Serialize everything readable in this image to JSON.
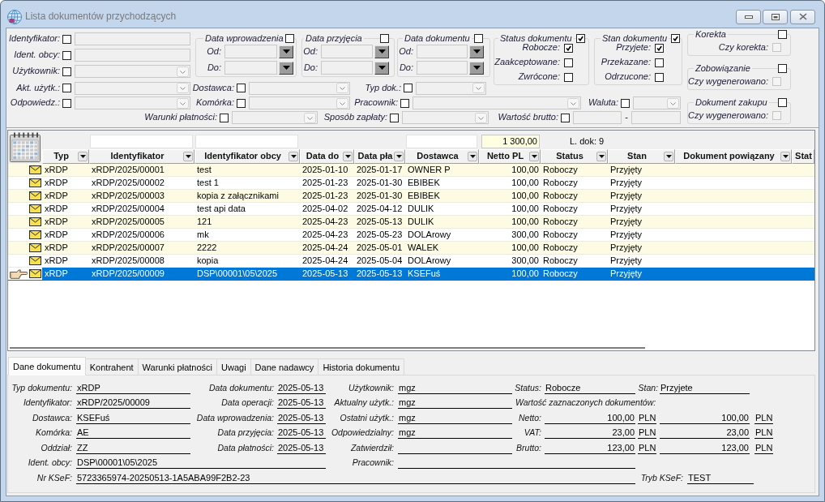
{
  "window": {
    "title": "Lista dokumentów przychodzących"
  },
  "filters": {
    "fields": [
      {
        "label": "Identyfikator:",
        "checked": false,
        "kind": "text"
      },
      {
        "label": "Ident. obcy:",
        "checked": false,
        "kind": "text"
      },
      {
        "label": "Użytkownik:",
        "checked": false,
        "kind": "combo"
      }
    ],
    "date_groups": [
      {
        "title": "Data wprowadzenia",
        "checked": false,
        "from_label": "Od:",
        "to_label": "Do:"
      },
      {
        "title": "Data przyjęcia",
        "checked": false,
        "from_label": "Od:",
        "to_label": "Do:"
      },
      {
        "title": "Data dokumentu",
        "checked": false,
        "from_label": "Od:",
        "to_label": "Do:"
      }
    ],
    "state_groups": [
      {
        "title": "Status dokumentu",
        "checked": true,
        "options": [
          {
            "label": "Robocze:",
            "checked": true
          },
          {
            "label": "Zaakceptowane:",
            "checked": false
          },
          {
            "label": "Zwrócone:",
            "checked": false
          }
        ]
      },
      {
        "title": "Stan dokumentu",
        "checked": true,
        "options": [
          {
            "label": "Przyjete:",
            "checked": true
          },
          {
            "label": "Przekazane:",
            "checked": false
          },
          {
            "label": "Odrzucone:",
            "checked": false
          }
        ]
      }
    ],
    "flag_groups": [
      {
        "title": "Korekta",
        "checked": false,
        "option": {
          "label": "Czy korekta:",
          "checked": false,
          "disabled": true
        }
      },
      {
        "title": "Zobowiązanie",
        "checked": false,
        "option": {
          "label": "Czy wygenerowano:",
          "checked": false,
          "disabled": true
        }
      },
      {
        "title": "Dokument zakupu",
        "checked": false,
        "option": {
          "label": "Czy wygenerowano:",
          "checked": false,
          "disabled": true
        }
      }
    ],
    "field_lines": [
      {
        "items": [
          {
            "label": "Akt. użytk.:",
            "checked": false,
            "kind": "combo"
          },
          {
            "label": "Dostawca:",
            "checked": false,
            "kind": "combo"
          },
          {
            "label": "Typ dok.:",
            "checked": false,
            "kind": "combo"
          }
        ]
      },
      {
        "items": [
          {
            "label": "Odpowiedz.:",
            "checked": false,
            "kind": "combo"
          },
          {
            "label": "Komórka:",
            "checked": false,
            "kind": "combo"
          },
          {
            "label": "Pracownik:",
            "checked": false,
            "kind": "combo"
          },
          {
            "label": "Waluta:",
            "checked": false,
            "kind": "combo"
          }
        ]
      },
      {
        "items": [
          {
            "label": "Warunki płatności:",
            "checked": false,
            "kind": "combo"
          },
          {
            "label": "Sposób zapłaty:",
            "checked": false,
            "kind": "combo"
          },
          {
            "label": "Wartość brutto:",
            "checked": false,
            "kind": "range",
            "separator": "-"
          }
        ]
      }
    ]
  },
  "grid": {
    "netto_total": "1 300,00",
    "document_count": "L. dok: 9",
    "columns": [
      "Typ",
      "Identyfikator",
      "Identyfikator obcy",
      "Data do",
      "Data pła",
      "Dostawca",
      "Netto PL",
      "Status",
      "Stan",
      "Dokument powiązany",
      "Stat"
    ],
    "rows": [
      {
        "selected": false,
        "cells": [
          "xRDP",
          "xRDP/2025/00001",
          "test",
          "2025-01-10",
          "2025-01-17",
          "OWNER P",
          "100,00",
          "Roboczy",
          "Przyjęty"
        ]
      },
      {
        "selected": false,
        "cells": [
          "xRDP",
          "xRDP/2025/00002",
          "test 1",
          "2025-01-23",
          "2025-01-30",
          "EBIBEK",
          "100,00",
          "Roboczy",
          "Przyjęty"
        ]
      },
      {
        "selected": false,
        "cells": [
          "xRDP",
          "xRDP/2025/00003",
          "kopia z załącznikami",
          "2025-01-23",
          "2025-01-30",
          "EBIBEK",
          "100,00",
          "Roboczy",
          "Przyjęty"
        ]
      },
      {
        "selected": false,
        "cells": [
          "xRDP",
          "xRDP/2025/00004",
          "test api data",
          "2025-04-02",
          "2025-04-12",
          "DULIK",
          "100,00",
          "Roboczy",
          "Przyjęty"
        ]
      },
      {
        "selected": false,
        "cells": [
          "xRDP",
          "xRDP/2025/00005",
          "121",
          "2025-04-23",
          "2025-05-13",
          "DULIK",
          "100,00",
          "Roboczy",
          "Przyjęty"
        ]
      },
      {
        "selected": false,
        "cells": [
          "xRDP",
          "xRDP/2025/00006",
          "mk",
          "2025-04-23",
          "2025-05-23",
          "DOLArowy",
          "300,00",
          "Roboczy",
          "Przyjęty"
        ]
      },
      {
        "selected": false,
        "cells": [
          "xRDP",
          "xRDP/2025/00007",
          "2222",
          "2025-04-24",
          "2025-05-01",
          "WALEK",
          "100,00",
          "Roboczy",
          "Przyjęty"
        ]
      },
      {
        "selected": false,
        "cells": [
          "xRDP",
          "xRDP/2025/00008",
          "kopia",
          "2025-04-24",
          "2025-05-04",
          "DOLArowy",
          "300,00",
          "Roboczy",
          "Przyjęty"
        ]
      },
      {
        "selected": true,
        "cells": [
          "xRDP",
          "xRDP/2025/00009",
          "DSP\\00001\\05\\2025",
          "2025-05-13",
          "2025-05-13",
          "KSEFuś",
          "100,00",
          "Roboczy",
          "Przyjęty"
        ]
      }
    ]
  },
  "detail_tabs": [
    {
      "label": "Dane dokumentu",
      "selected": true
    },
    {
      "label": "Kontrahent",
      "selected": false
    },
    {
      "label": "Warunki płatności",
      "selected": false
    },
    {
      "label": "Uwagi",
      "selected": false
    },
    {
      "label": "Dane nadawcy",
      "selected": false
    },
    {
      "label": "Historia dokumentu",
      "selected": false
    }
  ],
  "details": {
    "document": [
      {
        "label": "Typ dokumentu:",
        "value": "xRDP"
      },
      {
        "label": "Identyfikator:",
        "value": "xRDP/2025/00009"
      },
      {
        "label": "Dostawca:",
        "value": "KSEFuś"
      },
      {
        "label": "Komórka:",
        "value": "AE"
      },
      {
        "label": "Oddział:",
        "value": "ZZ"
      },
      {
        "label": "Ident. obcy:",
        "value": "DSP\\00001\\05\\2025"
      },
      {
        "label": "Nr KSeF:",
        "value": "5723365974-20250513-1A5ABA99F2B2-23"
      }
    ],
    "dates": [
      {
        "label": "Data dokumentu:",
        "value": "2025-05-13"
      },
      {
        "label": "Data operacji:",
        "value": "2025-05-13"
      },
      {
        "label": "Data wprowadzenia:",
        "value": "2025-05-13"
      },
      {
        "label": "Data przyjęcia:",
        "value": "2025-05-13"
      },
      {
        "label": "Data płatności:",
        "value": "2025-05-13"
      }
    ],
    "users": [
      {
        "label": "Użytkownik:",
        "value": "mgz"
      },
      {
        "label": "Aktualny użytk.:",
        "value": "mgz"
      },
      {
        "label": "Ostatni użytk.:",
        "value": "mgz"
      },
      {
        "label": "Odpowiedzialny:",
        "value": "mgz"
      },
      {
        "label": "Zatwierdził:"
      },
      {
        "label": "Pracownik:"
      }
    ],
    "status": {
      "label": "Status:",
      "value": "Robocze"
    },
    "state": {
      "label": "Stan:",
      "value": "Przyjete"
    },
    "selection_caption": "Wartość zaznaczonych dokumentów:",
    "amounts": [
      {
        "label": "Netto:",
        "value": "100,00",
        "currency": "PLN",
        "total": "100,00",
        "total_currency": "PLN"
      },
      {
        "label": "VAT:",
        "value": "23,00",
        "currency": "PLN",
        "total": "23,00",
        "total_currency": "PLN"
      },
      {
        "label": "Brutto:",
        "value": "123,00",
        "currency": "PLN",
        "total": "123,00",
        "total_currency": "PLN"
      }
    ],
    "ksef_mode": {
      "label": "Tryb KSeF:",
      "value": "TEST"
    }
  }
}
